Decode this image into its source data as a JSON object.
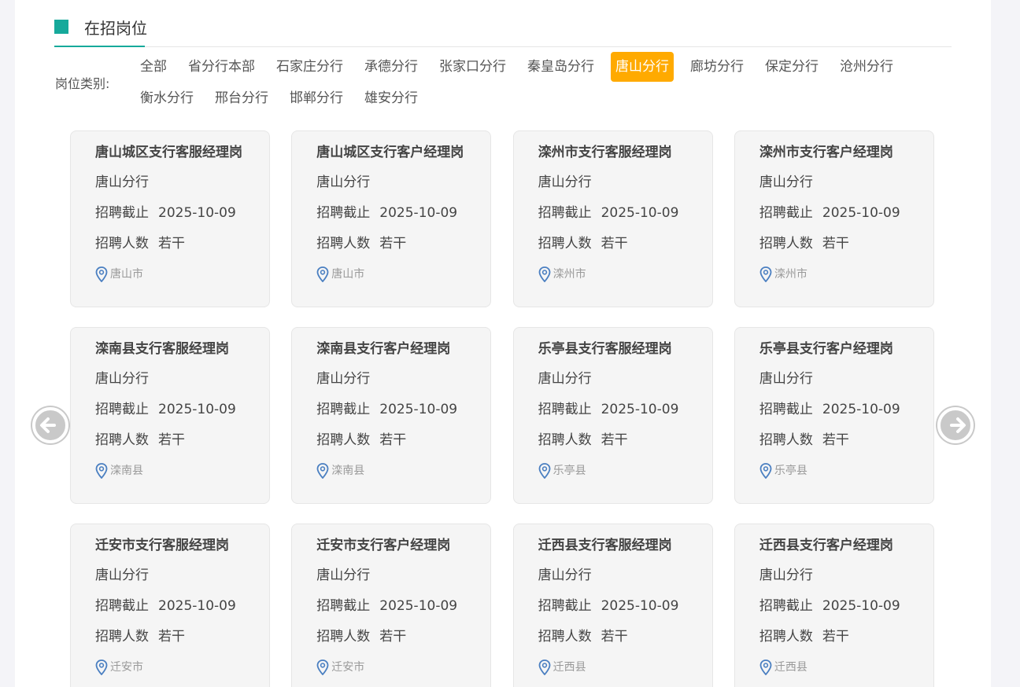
{
  "section": {
    "title": "在招岗位"
  },
  "filter": {
    "label": "岗位类别:",
    "items": [
      "全部",
      "省分行本部",
      "石家庄分行",
      "承德分行",
      "张家口分行",
      "秦皇岛分行",
      "唐山分行",
      "廊坊分行",
      "保定分行",
      "沧州分行",
      "衡水分行",
      "邢台分行",
      "邯郸分行",
      "雄安分行"
    ],
    "active": "唐山分行"
  },
  "labels": {
    "deadline": "招聘截止",
    "count": "招聘人数"
  },
  "cards": [
    {
      "title": "唐山城区支行客服经理岗",
      "branch": "唐山分行",
      "deadline": "2025-10-09",
      "count": "若干",
      "location": "唐山市"
    },
    {
      "title": "唐山城区支行客户经理岗",
      "branch": "唐山分行",
      "deadline": "2025-10-09",
      "count": "若干",
      "location": "唐山市"
    },
    {
      "title": "滦州市支行客服经理岗",
      "branch": "唐山分行",
      "deadline": "2025-10-09",
      "count": "若干",
      "location": "滦州市"
    },
    {
      "title": "滦州市支行客户经理岗",
      "branch": "唐山分行",
      "deadline": "2025-10-09",
      "count": "若干",
      "location": "滦州市"
    },
    {
      "title": "滦南县支行客服经理岗",
      "branch": "唐山分行",
      "deadline": "2025-10-09",
      "count": "若干",
      "location": "滦南县"
    },
    {
      "title": "滦南县支行客户经理岗",
      "branch": "唐山分行",
      "deadline": "2025-10-09",
      "count": "若干",
      "location": "滦南县"
    },
    {
      "title": "乐亭县支行客服经理岗",
      "branch": "唐山分行",
      "deadline": "2025-10-09",
      "count": "若干",
      "location": "乐亭县"
    },
    {
      "title": "乐亭县支行客户经理岗",
      "branch": "唐山分行",
      "deadline": "2025-10-09",
      "count": "若干",
      "location": "乐亭县"
    },
    {
      "title": "迁安市支行客服经理岗",
      "branch": "唐山分行",
      "deadline": "2025-10-09",
      "count": "若干",
      "location": "迁安市"
    },
    {
      "title": "迁安市支行客户经理岗",
      "branch": "唐山分行",
      "deadline": "2025-10-09",
      "count": "若干",
      "location": "迁安市"
    },
    {
      "title": "迁西县支行客服经理岗",
      "branch": "唐山分行",
      "deadline": "2025-10-09",
      "count": "若干",
      "location": "迁西县"
    },
    {
      "title": "迁西县支行客户经理岗",
      "branch": "唐山分行",
      "deadline": "2025-10-09",
      "count": "若干",
      "location": "迁西县"
    }
  ],
  "colors": {
    "accent": "#16a99b",
    "active_tab": "#ffaa00",
    "pin": "#4a7fc1"
  },
  "icons": {
    "section": "square-icon",
    "location": "location-pin-icon",
    "prev": "arrow-left-icon",
    "next": "arrow-right-icon"
  }
}
